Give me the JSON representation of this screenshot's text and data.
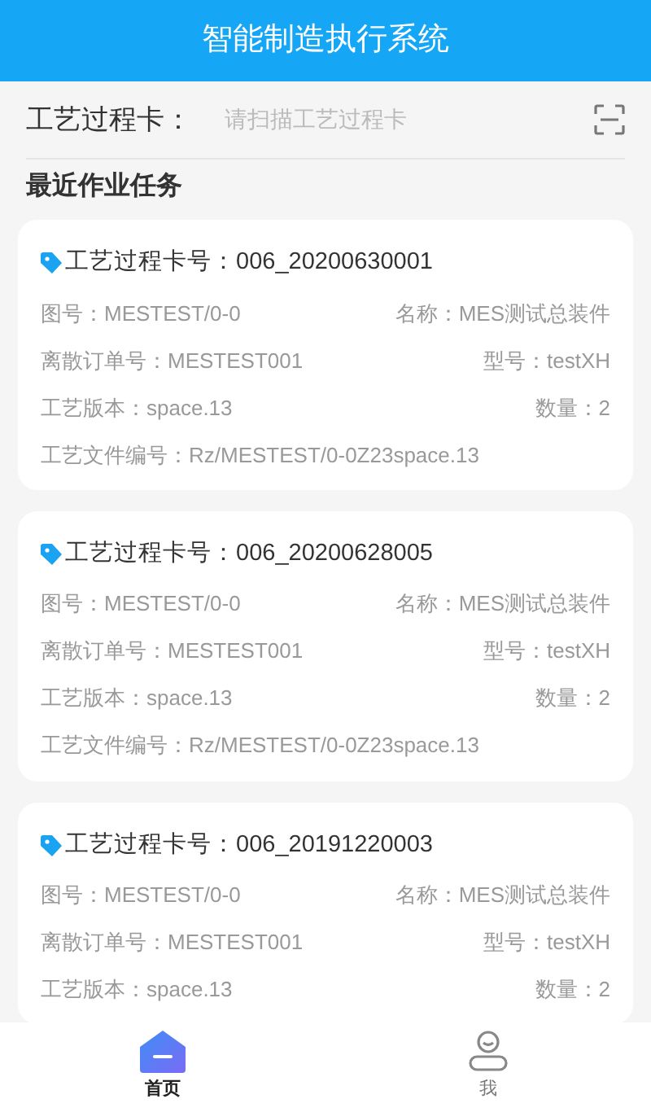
{
  "header": {
    "title": "智能制造执行系统"
  },
  "scan": {
    "label": "工艺过程卡：",
    "placeholder": "请扫描工艺过程卡"
  },
  "section_title": "最近作业任务",
  "cards": [
    {
      "title": "工艺过程卡号：006_20200630001",
      "rows": [
        {
          "left": "图号：MESTEST/0-0",
          "right": "名称：MES测试总装件"
        },
        {
          "left": "离散订单号：MESTEST001",
          "right": "型号：testXH"
        },
        {
          "left": "工艺版本：space.13",
          "right": "数量：2"
        },
        {
          "left": "工艺文件编号：Rz/MESTEST/0-0Z23space.13"
        }
      ]
    },
    {
      "title": "工艺过程卡号：006_20200628005",
      "rows": [
        {
          "left": "图号：MESTEST/0-0",
          "right": "名称：MES测试总装件"
        },
        {
          "left": "离散订单号：MESTEST001",
          "right": "型号：testXH"
        },
        {
          "left": "工艺版本：space.13",
          "right": "数量：2"
        },
        {
          "left": "工艺文件编号：Rz/MESTEST/0-0Z23space.13"
        }
      ]
    },
    {
      "title": "工艺过程卡号：006_20191220003",
      "rows": [
        {
          "left": "图号：MESTEST/0-0",
          "right": "名称：MES测试总装件"
        },
        {
          "left": "离散订单号：MESTEST001",
          "right": "型号：testXH"
        },
        {
          "left": "工艺版本：space.13",
          "right": "数量：2"
        }
      ]
    }
  ],
  "tabs": [
    {
      "label": "首页",
      "kind": "home",
      "selected": true
    },
    {
      "label": "我",
      "kind": "me",
      "selected": false
    }
  ]
}
